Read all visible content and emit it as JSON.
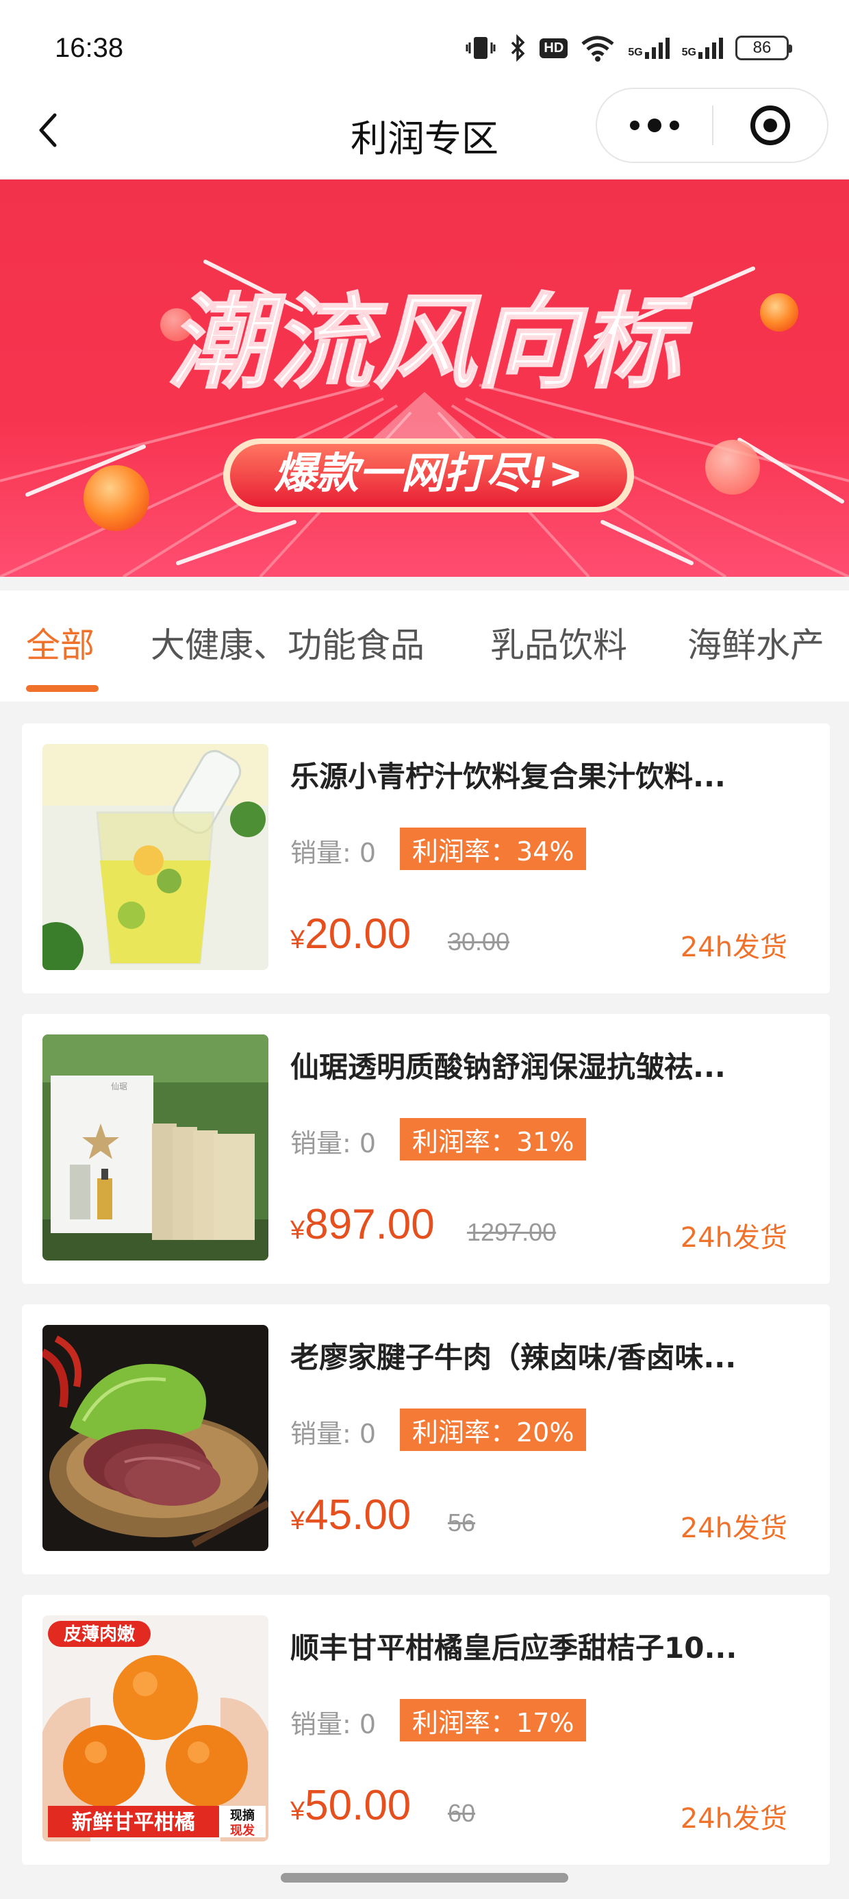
{
  "status_bar": {
    "time": "16:38",
    "hd": "HD",
    "net1": "5G",
    "net2": "5G",
    "battery": "86"
  },
  "nav": {
    "title": "利润专区"
  },
  "banner": {
    "headline": "潮流风向标",
    "button": "爆款一网打尽!>"
  },
  "tabs": [
    "全部",
    "大健康、功能食品",
    "乳品饮料",
    "海鲜水产"
  ],
  "products": [
    {
      "title": "乐源小青柠汁饮料复合果汁饮料...",
      "sales": "销量: 0",
      "profit": "利润率：34%",
      "currency": "¥",
      "price": "20.00",
      "orig_price": "30.00",
      "ship": "24h发货"
    },
    {
      "title": "仙琚透明质酸钠舒润保湿抗皱祛...",
      "sales": "销量: 0",
      "profit": "利润率：31%",
      "currency": "¥",
      "price": "897.00",
      "orig_price": "1297.00",
      "ship": "24h发货"
    },
    {
      "title": "老廖家腱子牛肉（辣卤味/香卤味...",
      "sales": "销量: 0",
      "profit": "利润率：20%",
      "currency": "¥",
      "price": "45.00",
      "orig_price": "56",
      "ship": "24h发货"
    },
    {
      "title": "顺丰甘平柑橘皇后应季甜桔子10...",
      "sales": "销量: 0",
      "profit": "利润率：17%",
      "currency": "¥",
      "price": "50.00",
      "orig_price": "60",
      "ship": "24h发货"
    }
  ],
  "product4_image_text": {
    "badge": "皮薄肉嫩",
    "bottom": "新鲜甘平柑橘",
    "tag1": "现摘",
    "tag2": "现发"
  }
}
